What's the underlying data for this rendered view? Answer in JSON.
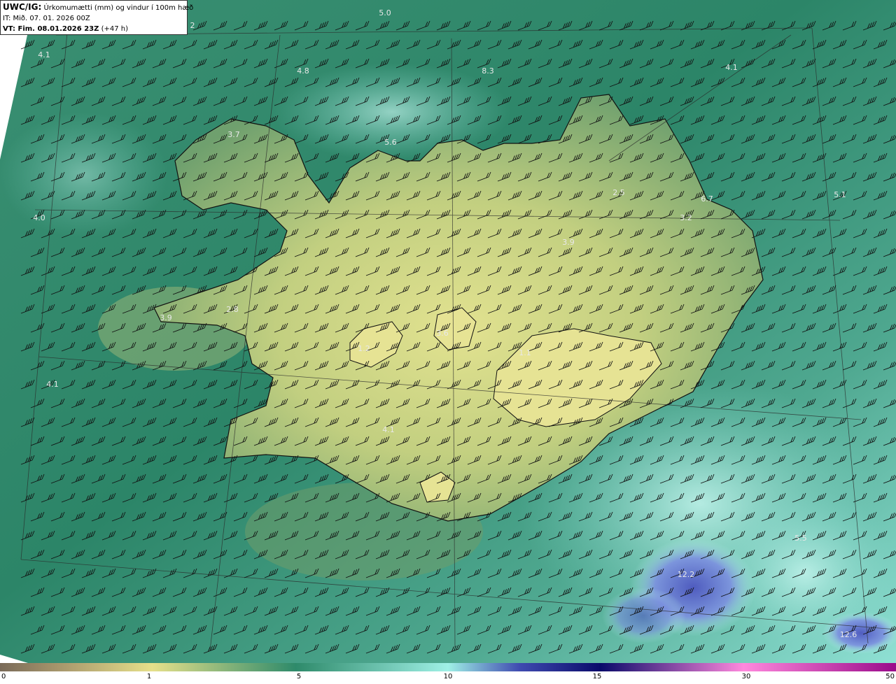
{
  "header": {
    "model": "UWC/IG:",
    "product": "Úrkomumætti (mm) og vindur í 100m hæð",
    "init_label": "IT: Mið. 07. 01. 2026 00Z",
    "valid_prefix": "VT: Fim. 08.01.2026 23Z",
    "valid_suffix": "(+47 h)"
  },
  "colors": {
    "ocean": "#2f8a6b",
    "land_low": "#5e9a6a",
    "land_high": "#d8df8a",
    "heavy_precip": "#5a5fc8",
    "coast": "#111111",
    "grid": "#2a2a2a"
  },
  "colorbar": {
    "ticks": [
      "0",
      "1",
      "5",
      "10",
      "15",
      "30",
      "50"
    ],
    "stops": [
      "#7a6a58",
      "#b0a070",
      "#e6e08a",
      "#2e8a6a",
      "#9ff0e6",
      "#2c2a9a",
      "#0a0a6a",
      "#ff88dd",
      "#9a0a8a"
    ]
  },
  "map_labels": [
    {
      "text": "5.0"
    },
    {
      "text": "2"
    },
    {
      "text": "4.1"
    },
    {
      "text": "4.8"
    },
    {
      "text": "8.3"
    },
    {
      "text": "4.1"
    },
    {
      "text": "3.7"
    },
    {
      "text": "5.6"
    },
    {
      "text": "4.0"
    },
    {
      "text": "2.5"
    },
    {
      "text": "6.7"
    },
    {
      "text": "5.1"
    },
    {
      "text": "3.2"
    },
    {
      "text": "3.9"
    },
    {
      "text": "2.8"
    },
    {
      "text": "3.9"
    },
    {
      "text": "4.1"
    },
    {
      "text": "1.2"
    },
    {
      "text": "3.6"
    },
    {
      "text": "1.1"
    },
    {
      "text": "4.1"
    },
    {
      "text": "12.2"
    },
    {
      "text": "12.6"
    },
    {
      "text": "5.5"
    }
  ]
}
